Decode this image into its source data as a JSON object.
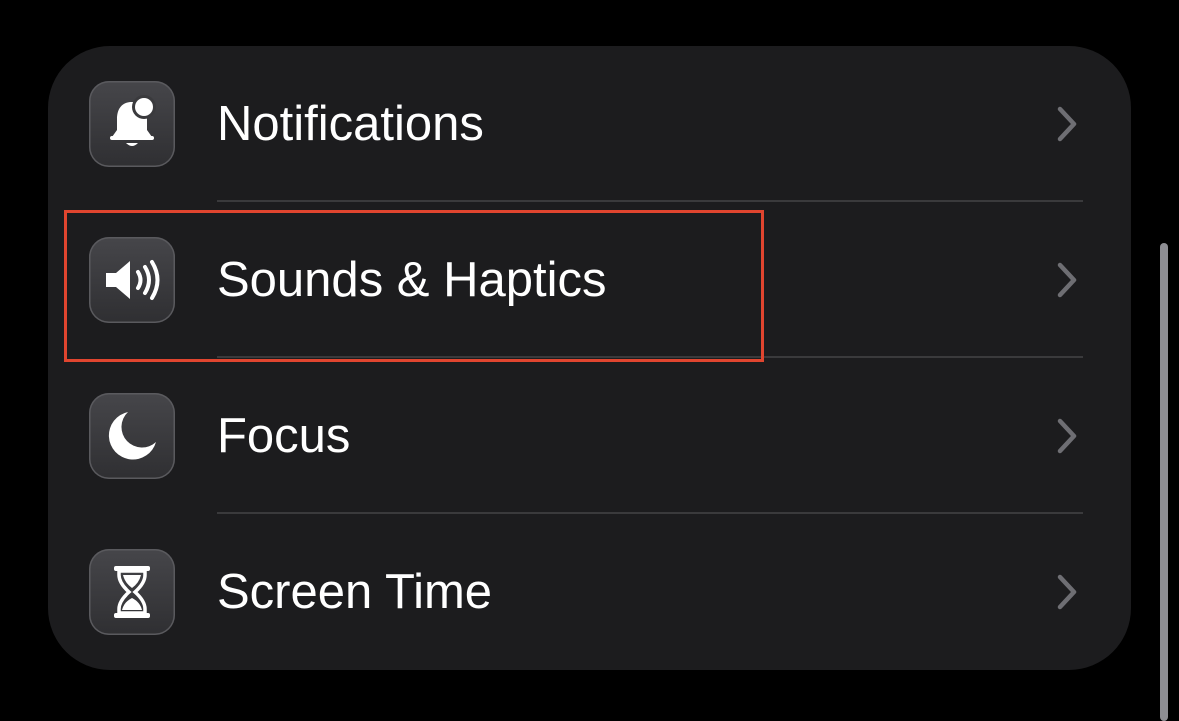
{
  "settings_list": {
    "items": [
      {
        "label": "Notifications",
        "icon": "bell-badge-icon"
      },
      {
        "label": "Sounds & Haptics",
        "icon": "speaker-wave-icon"
      },
      {
        "label": "Focus",
        "icon": "moon-icon"
      },
      {
        "label": "Screen Time",
        "icon": "hourglass-icon"
      }
    ]
  },
  "highlighted_item": "Sounds & Haptics",
  "colors": {
    "background": "#000000",
    "group_background": "#1c1c1e",
    "text": "#ffffff",
    "chevron": "#6e6e73",
    "separator": "#3a3a3c",
    "highlight": "#e0452f"
  }
}
